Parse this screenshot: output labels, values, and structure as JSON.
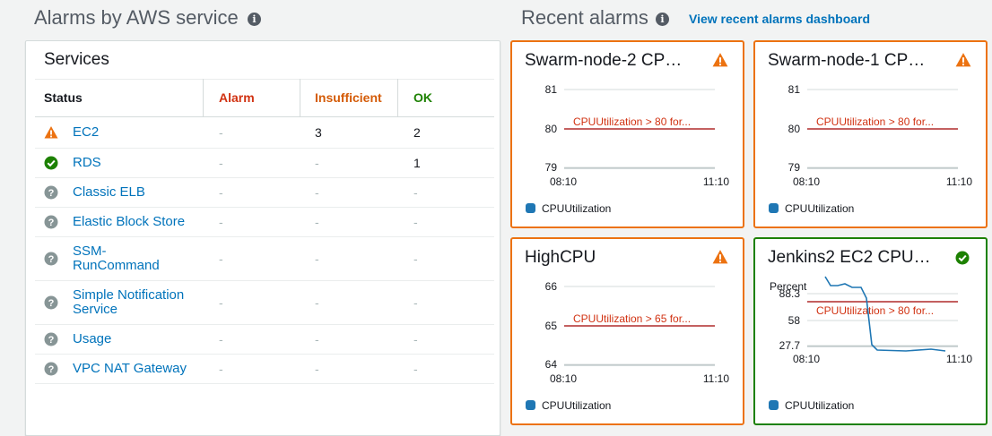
{
  "services_section": {
    "heading": "Alarms by AWS service",
    "panel_title": "Services",
    "columns": {
      "status": "Status",
      "alarm": "Alarm",
      "insufficient": "Insufficient",
      "ok": "OK"
    },
    "rows": [
      {
        "status_icon": "warning-icon",
        "name": "EC2",
        "alarm": "-",
        "insufficient": "3",
        "ok": "2"
      },
      {
        "status_icon": "check-icon",
        "name": "RDS",
        "alarm": "-",
        "insufficient": "-",
        "ok": "1"
      },
      {
        "status_icon": "question-icon",
        "name": "Classic ELB",
        "alarm": "-",
        "insufficient": "-",
        "ok": "-"
      },
      {
        "status_icon": "question-icon",
        "name": "Elastic Block Store",
        "alarm": "-",
        "insufficient": "-",
        "ok": "-"
      },
      {
        "status_icon": "question-icon",
        "name": "SSM-\nRunCommand",
        "alarm": "-",
        "insufficient": "-",
        "ok": "-"
      },
      {
        "status_icon": "question-icon",
        "name": "Simple Notification\nService",
        "alarm": "-",
        "insufficient": "-",
        "ok": "-"
      },
      {
        "status_icon": "question-icon",
        "name": "Usage",
        "alarm": "-",
        "insufficient": "-",
        "ok": "-"
      },
      {
        "status_icon": "question-icon",
        "name": "VPC NAT Gateway",
        "alarm": "-",
        "insufficient": "-",
        "ok": "-"
      }
    ]
  },
  "recent_section": {
    "heading": "Recent alarms",
    "dashboard_link": "View recent alarms dashboard",
    "cards": [
      {
        "title": "Swarm-node-2 CP…",
        "state": "warning",
        "y_ticks": [
          "81",
          "80",
          "79"
        ],
        "x_ticks": [
          "08:10",
          "11:10"
        ],
        "threshold_label": "CPUUtilization > 80 for...",
        "legend": "CPUUtilization",
        "unit_label": ""
      },
      {
        "title": "Swarm-node-1 CP…",
        "state": "warning",
        "y_ticks": [
          "81",
          "80",
          "79"
        ],
        "x_ticks": [
          "08:10",
          "11:10"
        ],
        "threshold_label": "CPUUtilization > 80 for...",
        "legend": "CPUUtilization",
        "unit_label": ""
      },
      {
        "title": "HighCPU",
        "state": "warning",
        "y_ticks": [
          "66",
          "65",
          "64"
        ],
        "x_ticks": [
          "08:10",
          "11:10"
        ],
        "threshold_label": "CPUUtilization > 65 for...",
        "legend": "CPUUtilization",
        "unit_label": ""
      },
      {
        "title": "Jenkins2 EC2 CPU…",
        "state": "ok",
        "y_ticks": [
          "88.3",
          "58",
          "27.7"
        ],
        "x_ticks": [
          "08:10",
          "11:10"
        ],
        "threshold_label": "CPUUtilization > 80 for...",
        "legend": "CPUUtilization",
        "unit_label": "Percent"
      }
    ]
  },
  "colors": {
    "alarm_header": "#d13212",
    "insufficient_header": "#d45b07",
    "ok_header": "#1d8102",
    "warning_border": "#ec7211",
    "ok_border": "#1d8102",
    "series": "#1f77b4",
    "link": "#0073bb"
  }
}
